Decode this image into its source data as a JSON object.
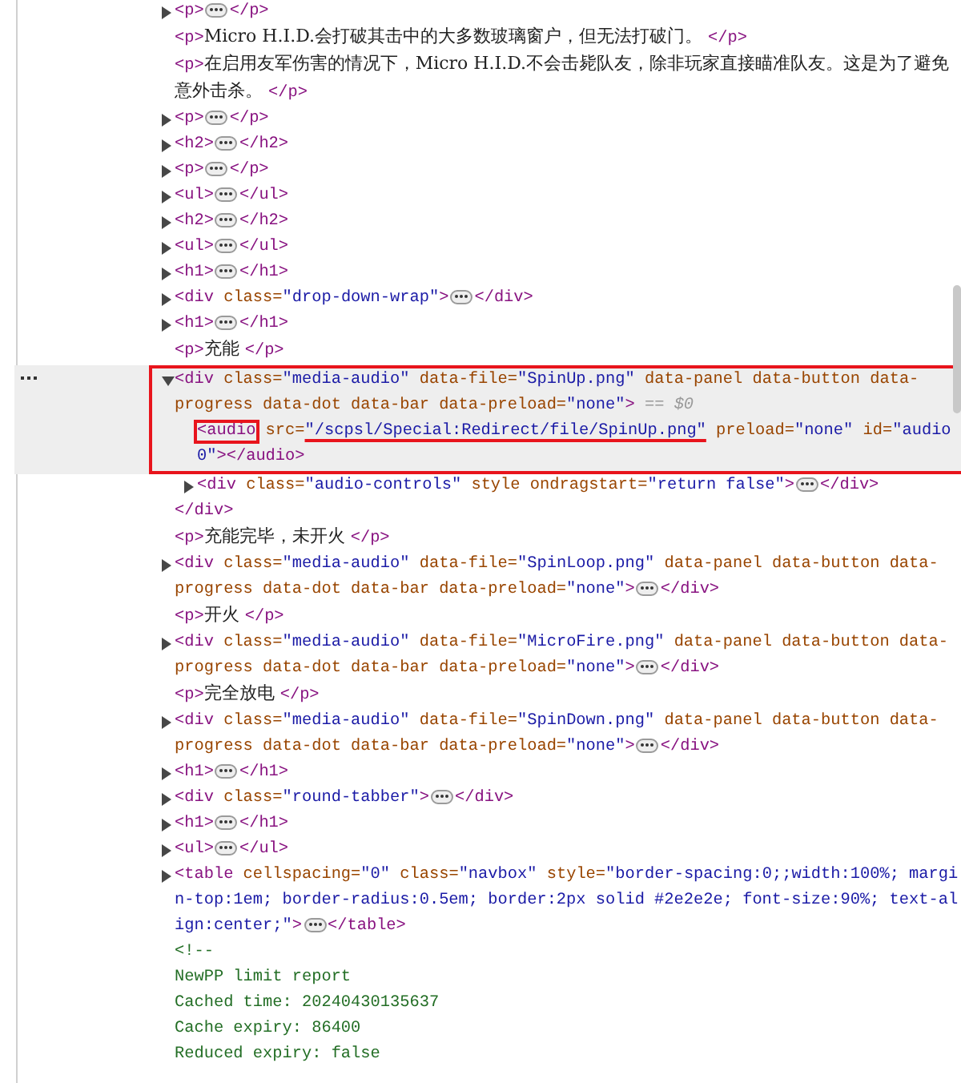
{
  "nodes": [
    {
      "kind": "collapsed",
      "selected": false,
      "open": [
        {
          "kind": "tag",
          "text": "<p>"
        }
      ],
      "close": [
        {
          "kind": "tag",
          "text": "</p>"
        }
      ]
    },
    {
      "kind": "leaf",
      "selected": false,
      "tokens": [
        {
          "kind": "tag",
          "text": "<p>"
        },
        {
          "kind": "text",
          "text": "Micro H.I.D.会打破其击中的大多数玻璃窗户，但无法打破门。 "
        },
        {
          "kind": "tag",
          "text": "</p>"
        }
      ]
    },
    {
      "kind": "leaf",
      "selected": false,
      "tokens": [
        {
          "kind": "tag",
          "text": "<p>"
        },
        {
          "kind": "text",
          "text": "在启用友军伤害的情况下，Micro H.I.D.不会击毙队友，除非玩家直接瞄准队友。这是为了避免意外击杀。 "
        },
        {
          "kind": "tag",
          "text": "</p>"
        }
      ]
    },
    {
      "kind": "collapsed",
      "selected": false,
      "open": [
        {
          "kind": "tag",
          "text": "<p>"
        }
      ],
      "close": [
        {
          "kind": "tag",
          "text": "</p>"
        }
      ]
    },
    {
      "kind": "collapsed",
      "selected": false,
      "open": [
        {
          "kind": "tag",
          "text": "<h2>"
        }
      ],
      "close": [
        {
          "kind": "tag",
          "text": "</h2>"
        }
      ]
    },
    {
      "kind": "collapsed",
      "selected": false,
      "open": [
        {
          "kind": "tag",
          "text": "<p>"
        }
      ],
      "close": [
        {
          "kind": "tag",
          "text": "</p>"
        }
      ]
    },
    {
      "kind": "collapsed",
      "selected": false,
      "open": [
        {
          "kind": "tag",
          "text": "<ul>"
        }
      ],
      "close": [
        {
          "kind": "tag",
          "text": "</ul>"
        }
      ]
    },
    {
      "kind": "collapsed",
      "selected": false,
      "open": [
        {
          "kind": "tag",
          "text": "<h2>"
        }
      ],
      "close": [
        {
          "kind": "tag",
          "text": "</h2>"
        }
      ]
    },
    {
      "kind": "collapsed",
      "selected": false,
      "open": [
        {
          "kind": "tag",
          "text": "<ul>"
        }
      ],
      "close": [
        {
          "kind": "tag",
          "text": "</ul>"
        }
      ]
    },
    {
      "kind": "collapsed",
      "selected": false,
      "open": [
        {
          "kind": "tag",
          "text": "<h1>"
        }
      ],
      "close": [
        {
          "kind": "tag",
          "text": "</h1>"
        }
      ]
    },
    {
      "kind": "collapsed",
      "selected": false,
      "open": [
        {
          "kind": "tag",
          "text": "<div"
        },
        {
          "kind": "attr",
          "text": " class="
        },
        {
          "kind": "value",
          "text": "\"drop-down-wrap\""
        },
        {
          "kind": "tag",
          "text": ">"
        }
      ],
      "close": [
        {
          "kind": "tag",
          "text": "</div>"
        }
      ]
    },
    {
      "kind": "collapsed",
      "selected": false,
      "open": [
        {
          "kind": "tag",
          "text": "<h1>"
        }
      ],
      "close": [
        {
          "kind": "tag",
          "text": "</h1>"
        }
      ]
    },
    {
      "kind": "leaf",
      "selected": false,
      "tokens": [
        {
          "kind": "tag",
          "text": "<p>"
        },
        {
          "kind": "text",
          "text": "充能 "
        },
        {
          "kind": "tag",
          "text": "</p>"
        }
      ]
    },
    {
      "kind": "expanded",
      "selected": true,
      "boxed": true,
      "open": [
        {
          "kind": "tag",
          "text": "<div"
        },
        {
          "kind": "attr",
          "text": " class="
        },
        {
          "kind": "value",
          "text": "\"media-audio\""
        },
        {
          "kind": "attr",
          "text": " data-file="
        },
        {
          "kind": "value",
          "text": "\"SpinUp.png\""
        },
        {
          "kind": "attr",
          "text": " data-panel data-button data-progress data-dot data-bar data-preload="
        },
        {
          "kind": "value",
          "text": "\"none\""
        },
        {
          "kind": "tag",
          "text": ">"
        },
        {
          "kind": "marker",
          "text": " == $0"
        }
      ],
      "children": [
        {
          "kind": "leaf",
          "selected": false,
          "boxed": true,
          "tokens": [
            {
              "kind": "tag",
              "text": "<audio",
              "boxed": true
            },
            {
              "kind": "attr",
              "text": " src="
            },
            {
              "kind": "value",
              "text": "\"/scpsl/Special:Redirect/file/SpinUp.png\"",
              "underlined": true
            },
            {
              "kind": "attr",
              "text": " preload="
            },
            {
              "kind": "value",
              "text": "\"none\""
            },
            {
              "kind": "attr",
              "text": " id="
            },
            {
              "kind": "value",
              "text": "\"audio0\""
            },
            {
              "kind": "tag",
              "text": "></audio>"
            }
          ]
        },
        {
          "kind": "collapsed",
          "selected": false,
          "open": [
            {
              "kind": "tag",
              "text": "<div"
            },
            {
              "kind": "attr",
              "text": " class="
            },
            {
              "kind": "value",
              "text": "\"audio-controls\""
            },
            {
              "kind": "attr",
              "text": " style ondragstart="
            },
            {
              "kind": "value",
              "text": "\"return false\""
            },
            {
              "kind": "tag",
              "text": ">"
            }
          ],
          "close": [
            {
              "kind": "tag",
              "text": "</div>"
            }
          ]
        }
      ],
      "close": [
        {
          "kind": "tag",
          "text": "</div>"
        }
      ]
    },
    {
      "kind": "leaf",
      "selected": false,
      "tokens": [
        {
          "kind": "tag",
          "text": "<p>"
        },
        {
          "kind": "text",
          "text": "充能完毕，未开火 "
        },
        {
          "kind": "tag",
          "text": "</p>"
        }
      ]
    },
    {
      "kind": "collapsed",
      "selected": false,
      "open": [
        {
          "kind": "tag",
          "text": "<div"
        },
        {
          "kind": "attr",
          "text": " class="
        },
        {
          "kind": "value",
          "text": "\"media-audio\""
        },
        {
          "kind": "attr",
          "text": " data-file="
        },
        {
          "kind": "value",
          "text": "\"SpinLoop.png\""
        },
        {
          "kind": "attr",
          "text": " data-panel data-button data-progress data-dot data-bar data-preload="
        },
        {
          "kind": "value",
          "text": "\"none\""
        },
        {
          "kind": "tag",
          "text": ">"
        }
      ],
      "close": [
        {
          "kind": "tag",
          "text": "</div>"
        }
      ]
    },
    {
      "kind": "leaf",
      "selected": false,
      "tokens": [
        {
          "kind": "tag",
          "text": "<p>"
        },
        {
          "kind": "text",
          "text": "开火 "
        },
        {
          "kind": "tag",
          "text": "</p>"
        }
      ]
    },
    {
      "kind": "collapsed",
      "selected": false,
      "open": [
        {
          "kind": "tag",
          "text": "<div"
        },
        {
          "kind": "attr",
          "text": " class="
        },
        {
          "kind": "value",
          "text": "\"media-audio\""
        },
        {
          "kind": "attr",
          "text": " data-file="
        },
        {
          "kind": "value",
          "text": "\"MicroFire.png\""
        },
        {
          "kind": "attr",
          "text": " data-panel data-button data-progress data-dot data-bar data-preload="
        },
        {
          "kind": "value",
          "text": "\"none\""
        },
        {
          "kind": "tag",
          "text": ">"
        }
      ],
      "close": [
        {
          "kind": "tag",
          "text": "</div>"
        }
      ]
    },
    {
      "kind": "leaf",
      "selected": false,
      "tokens": [
        {
          "kind": "tag",
          "text": "<p>"
        },
        {
          "kind": "text",
          "text": "完全放电 "
        },
        {
          "kind": "tag",
          "text": "</p>"
        }
      ]
    },
    {
      "kind": "collapsed",
      "selected": false,
      "open": [
        {
          "kind": "tag",
          "text": "<div"
        },
        {
          "kind": "attr",
          "text": " class="
        },
        {
          "kind": "value",
          "text": "\"media-audio\""
        },
        {
          "kind": "attr",
          "text": " data-file="
        },
        {
          "kind": "value",
          "text": "\"SpinDown.png\""
        },
        {
          "kind": "attr",
          "text": " data-panel data-button data-progress data-dot data-bar data-preload="
        },
        {
          "kind": "value",
          "text": "\"none\""
        },
        {
          "kind": "tag",
          "text": ">"
        }
      ],
      "close": [
        {
          "kind": "tag",
          "text": "</div>"
        }
      ]
    },
    {
      "kind": "collapsed",
      "selected": false,
      "open": [
        {
          "kind": "tag",
          "text": "<h1>"
        }
      ],
      "close": [
        {
          "kind": "tag",
          "text": "</h1>"
        }
      ]
    },
    {
      "kind": "collapsed",
      "selected": false,
      "open": [
        {
          "kind": "tag",
          "text": "<div"
        },
        {
          "kind": "attr",
          "text": " class="
        },
        {
          "kind": "value",
          "text": "\"round-tabber\""
        },
        {
          "kind": "tag",
          "text": ">"
        }
      ],
      "close": [
        {
          "kind": "tag",
          "text": "</div>"
        }
      ]
    },
    {
      "kind": "collapsed",
      "selected": false,
      "open": [
        {
          "kind": "tag",
          "text": "<h1>"
        }
      ],
      "close": [
        {
          "kind": "tag",
          "text": "</h1>"
        }
      ]
    },
    {
      "kind": "collapsed",
      "selected": false,
      "open": [
        {
          "kind": "tag",
          "text": "<ul>"
        }
      ],
      "close": [
        {
          "kind": "tag",
          "text": "</ul>"
        }
      ]
    },
    {
      "kind": "collapsed",
      "selected": false,
      "open": [
        {
          "kind": "tag",
          "text": "<table"
        },
        {
          "kind": "attr",
          "text": " cellspacing="
        },
        {
          "kind": "value",
          "text": "\"0\""
        },
        {
          "kind": "attr",
          "text": " class="
        },
        {
          "kind": "value",
          "text": "\"navbox\""
        },
        {
          "kind": "attr",
          "text": " style="
        },
        {
          "kind": "value",
          "text": "\"border-spacing:0;;width:100%; margin-top:1em; border-radius:0.5em; border:2px solid #2e2e2e; font-size:90%; text-align:center;\""
        },
        {
          "kind": "tag",
          "text": ">"
        }
      ],
      "close": [
        {
          "kind": "tag",
          "text": "</table>"
        }
      ]
    },
    {
      "kind": "comment",
      "selected": false,
      "lines": [
        "<!--",
        "NewPP limit report",
        "Cached time: 20240430135637",
        "Cache expiry: 86400",
        "Reduced expiry: false"
      ]
    }
  ]
}
